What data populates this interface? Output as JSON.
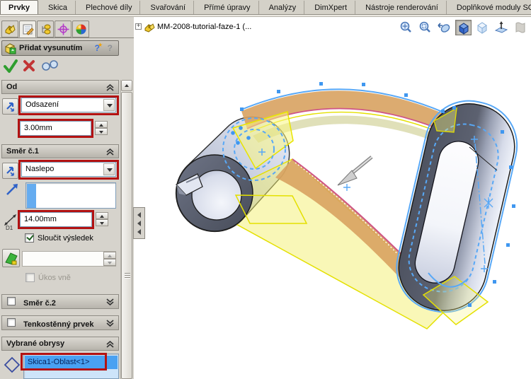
{
  "ribbon": {
    "tabs": [
      {
        "label": "Prvky",
        "active": true
      },
      {
        "label": "Skica",
        "active": false
      },
      {
        "label": "Plechové díly",
        "active": false
      },
      {
        "label": "Svařování",
        "active": false
      },
      {
        "label": "Přímé úpravy",
        "active": false
      },
      {
        "label": "Analýzy",
        "active": false
      },
      {
        "label": "DimXpert",
        "active": false
      },
      {
        "label": "Nástroje renderování",
        "active": false
      },
      {
        "label": "Doplňkové moduly SOLIDWO",
        "active": false
      }
    ]
  },
  "manager_tabs": {
    "icons": [
      "feature-manager-icon",
      "property-manager-icon",
      "configuration-manager-icon",
      "dimxpert-manager-icon",
      "display-manager-icon"
    ],
    "active_index": 1
  },
  "property_manager": {
    "title": "Přidat vysunutím",
    "actions": {
      "ok": "ok-checkmark",
      "cancel": "cancel-x",
      "preview": "detailed-preview-glasses"
    },
    "from": {
      "header": "Od",
      "type_value": "Odsazení",
      "offset_value": "3.00mm"
    },
    "direction1": {
      "header": "Směr č.1",
      "type_value": "Naslepo",
      "depth_label": "D1",
      "depth_value": "14.00mm",
      "merge_label": "Sloučit výsledek",
      "merge_checked": true,
      "draft_outward_label": "Úkos vně",
      "draft_outward_checked": false
    },
    "direction2": {
      "header": "Směr č.2"
    },
    "thin_feature": {
      "header": "Tenkostěnný prvek"
    },
    "selected_contours": {
      "header": "Vybrané obrysy",
      "items": [
        "Skica1-Oblast<1>"
      ]
    }
  },
  "viewport": {
    "feature_tree_item": "MM-2008-tutorial-faze-1 (...",
    "view_toolbar_icons": [
      "zoom-to-fit",
      "zoom-to-area",
      "previous-view",
      "view-orientation",
      "display-style",
      "section-view",
      "realview"
    ],
    "view_toolbar_pressed": "view-orientation"
  },
  "colors": {
    "annotation_red": "#b31212",
    "sketch_blue": "#58a8f6",
    "preview_yellow": "#f2ee2e",
    "selection_blue": "#49a1f2",
    "panel_bg": "#d6d3cc"
  }
}
